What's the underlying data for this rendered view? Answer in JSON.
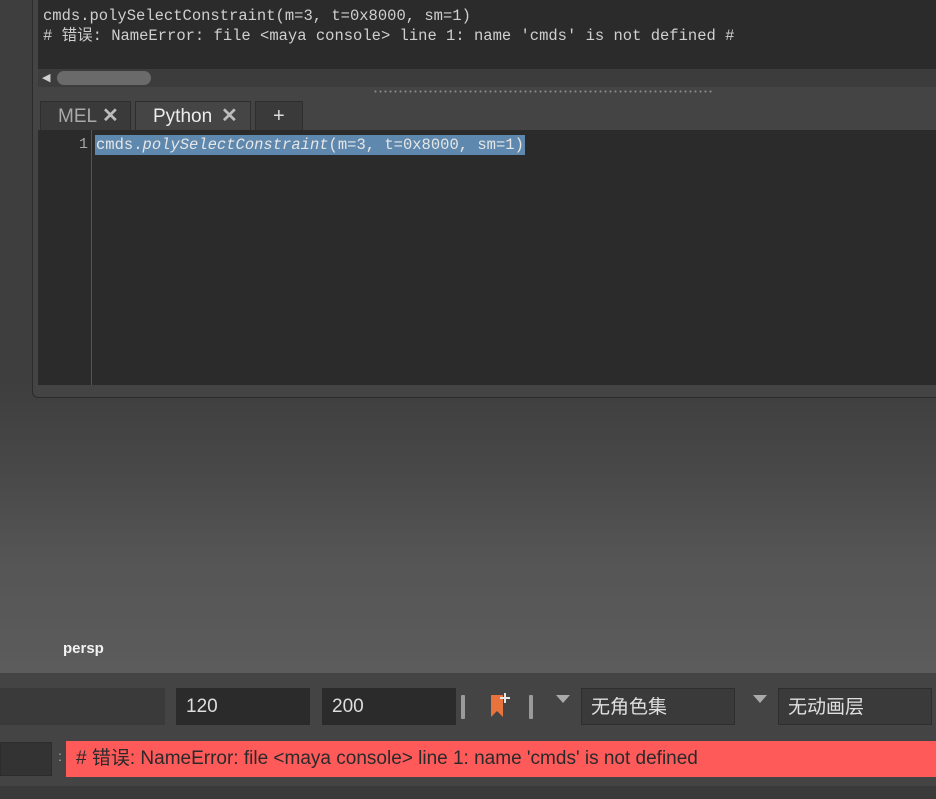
{
  "history": {
    "line1": "cmds.polySelectConstraint(m=3, t=0x8000, sm=1)",
    "line2": "# 错误: NameError: file <maya console> line 1: name 'cmds' is not defined #"
  },
  "tabs": [
    {
      "label": "MEL"
    },
    {
      "label": "Python"
    }
  ],
  "tab_close_glyph": "✕",
  "tab_add_glyph": "+",
  "editor": {
    "line_number": "1",
    "code_object": "cmds.",
    "code_function": "polySelectConstraint",
    "code_args": "(m=3, t=0x8000, sm=1)"
  },
  "viewport": {
    "camera_label": "persp"
  },
  "range_bar": {
    "start_field": "",
    "range_end": "120",
    "anim_end": "200",
    "character_set": "无角色集",
    "anim_layer": "无动画层"
  },
  "command_line": {
    "input": "",
    "separator": ":",
    "message": "# 错误: NameError: file <maya console> line 1: name 'cmds' is not defined",
    "error_color": "#fe5a5a"
  },
  "colors": {
    "selection": "#5e88ad",
    "bookmark": "#e8733c"
  },
  "icons": [
    "scroll-left-arrow-icon",
    "close-icon",
    "plus-icon",
    "bookmark-add-icon",
    "dropdown-arrow-icon"
  ]
}
